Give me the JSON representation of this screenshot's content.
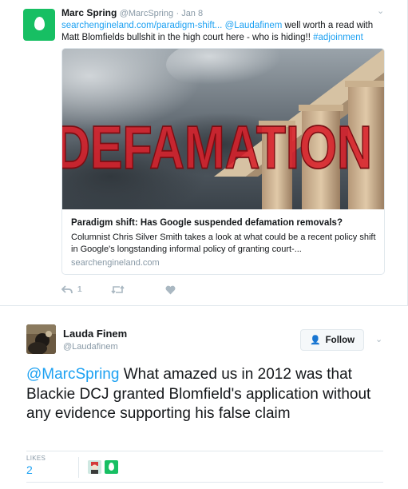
{
  "context_tweet": {
    "name": "Marc Spring",
    "handle": "@MarcSpring",
    "time": "· Jan 8",
    "text_link": "searchengineland.com/paradigm-shift...",
    "text_mention": "@Laudafinem",
    "text_body": " well worth a read with Matt Blomfields bullshit in the high court here - who is hiding!! ",
    "text_hashtag": "#adjoinment",
    "card": {
      "image_overlay_text": "DEFAMATION",
      "title": "Paradigm shift: Has Google suspended defamation removals?",
      "description": "Columnist Chris Silver Smith takes a look at what could be a recent policy shift in Google's longstanding informal policy of granting court-...",
      "domain": "searchengineland.com"
    },
    "actions": {
      "reply_count": "1"
    }
  },
  "main_tweet": {
    "name": "Lauda Finem",
    "handle": "@Laudafinem",
    "follow_label": "Follow",
    "text_mention": "@MarcSpring",
    "text_body": " What amazed us in 2012 was that Blackie DCJ granted Blomfield's application without any evidence supporting his false claim",
    "likes_label": "LIKES",
    "likes_count": "2"
  },
  "colors": {
    "link": "#1da1f2",
    "muted": "#8899a6",
    "egg_avatar": "#17bf63",
    "overlay_red": "#d8202a"
  }
}
